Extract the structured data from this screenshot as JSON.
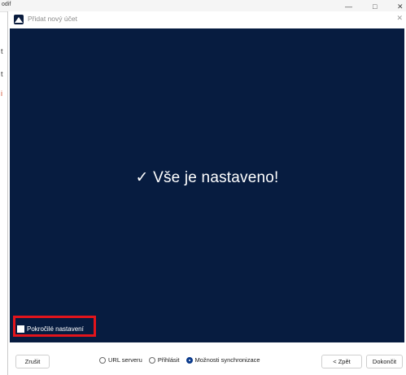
{
  "background_app": {
    "top_left_text": "odif",
    "side_fragments": [
      "t",
      "t",
      "i"
    ],
    "window_controls": [
      "—",
      "□",
      "✕"
    ]
  },
  "dialog": {
    "title": "Přidat nový účet",
    "icon": "cloud-app-icon",
    "close_glyph": "✕"
  },
  "content": {
    "message": "✓ Vše je nastaveno!",
    "advanced_checkbox": {
      "label": "Pokročilé nastavení",
      "checked": false
    },
    "highlight_color": "#e3141b",
    "background_color": "#071c40"
  },
  "footer": {
    "cancel_label": "Zrušit",
    "steps": [
      {
        "label": "URL serveru",
        "active": false
      },
      {
        "label": "Přihlásit",
        "active": false
      },
      {
        "label": "Možnosti synchronizace",
        "active": true
      }
    ],
    "back_label": "< Zpět",
    "finish_label": "Dokončit"
  }
}
